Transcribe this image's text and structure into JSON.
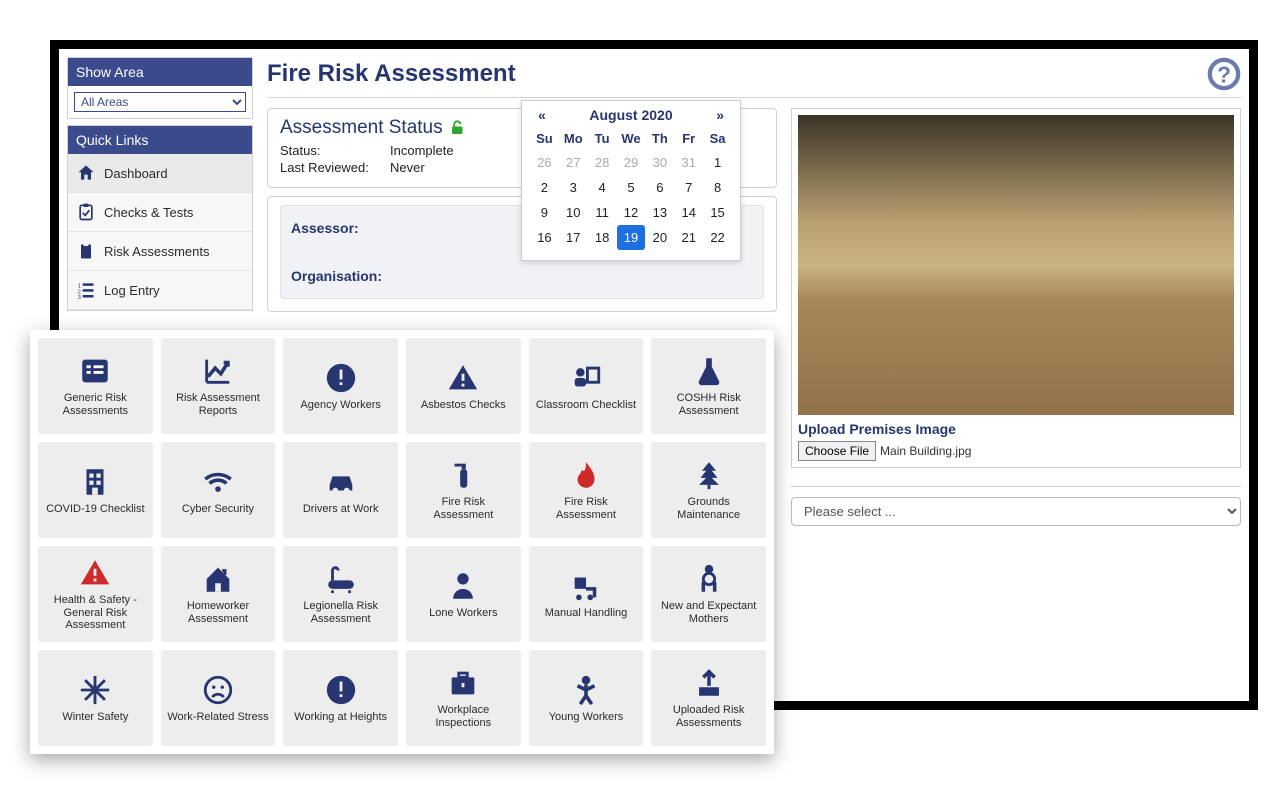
{
  "sidebar": {
    "show_area_title": "Show Area",
    "area_select_value": "All Areas",
    "quick_links_title": "Quick Links",
    "items": [
      {
        "icon": "home-icon",
        "label": "Dashboard"
      },
      {
        "icon": "clipboard-check-icon",
        "label": "Checks & Tests"
      },
      {
        "icon": "clipboard-icon",
        "label": "Risk Assessments"
      },
      {
        "icon": "list-number-icon",
        "label": "Log Entry"
      }
    ]
  },
  "page": {
    "title": "Fire Risk Assessment"
  },
  "status_panel": {
    "title": "Assessment Status",
    "lock_state": "unlocked",
    "rows": {
      "status_label": "Status:",
      "status_value": "Incomplete",
      "last_reviewed_label": "Last Reviewed:",
      "last_reviewed_value": "Never"
    }
  },
  "form": {
    "assessor_label": "Assessor:",
    "organisation_label": "Organisation:"
  },
  "calendar": {
    "prev": "«",
    "next": "»",
    "month_label": "August 2020",
    "dow": [
      "Su",
      "Mo",
      "Tu",
      "We",
      "Th",
      "Fr",
      "Sa"
    ],
    "rows": [
      {
        "days": [
          26,
          27,
          28,
          29,
          30,
          31,
          1
        ],
        "other": [
          0,
          1,
          2,
          3,
          4,
          5
        ]
      },
      {
        "days": [
          2,
          3,
          4,
          5,
          6,
          7,
          8
        ],
        "other": []
      },
      {
        "days": [
          9,
          10,
          11,
          12,
          13,
          14,
          15
        ],
        "other": []
      },
      {
        "days": [
          16,
          17,
          18,
          19,
          20,
          21,
          22
        ],
        "other": []
      }
    ],
    "selected": 19
  },
  "premises": {
    "upload_title": "Upload Premises Image",
    "choose_label": "Choose File",
    "file_name": "Main Building.jpg"
  },
  "lower_select_placeholder": "Please select ...",
  "tiles": [
    {
      "icon": "list-icon",
      "color": "navy",
      "label": "Generic Risk Assessments"
    },
    {
      "icon": "chart-line-icon",
      "color": "navy",
      "label": "Risk Assessment Reports"
    },
    {
      "icon": "exclaim-circle-icon",
      "color": "navy",
      "label": "Agency Workers"
    },
    {
      "icon": "warning-icon",
      "color": "navy",
      "label": "Asbestos Checks"
    },
    {
      "icon": "teacher-icon",
      "color": "navy",
      "label": "Classroom Checklist"
    },
    {
      "icon": "flask-icon",
      "color": "navy",
      "label": "COSHH Risk Assessment"
    },
    {
      "icon": "building-icon",
      "color": "navy",
      "label": "COVID-19 Checklist"
    },
    {
      "icon": "wifi-icon",
      "color": "navy",
      "label": "Cyber Security"
    },
    {
      "icon": "car-icon",
      "color": "navy",
      "label": "Drivers at Work"
    },
    {
      "icon": "extinguisher-icon",
      "color": "navy",
      "label": "Fire Risk Assessment"
    },
    {
      "icon": "flame-icon",
      "color": "red",
      "label": "Fire Risk Assessment"
    },
    {
      "icon": "tree-icon",
      "color": "navy",
      "label": "Grounds Maintenance"
    },
    {
      "icon": "warning-icon",
      "color": "red",
      "label": "Health & Safety - General Risk Assessment"
    },
    {
      "icon": "house-icon",
      "color": "navy",
      "label": "Homeworker Assessment"
    },
    {
      "icon": "bath-icon",
      "color": "navy",
      "label": "Legionella Risk Assessment"
    },
    {
      "icon": "person-icon",
      "color": "navy",
      "label": "Lone Workers"
    },
    {
      "icon": "trolley-icon",
      "color": "navy",
      "label": "Manual Handling"
    },
    {
      "icon": "mother-icon",
      "color": "navy",
      "label": "New and Expectant Mothers"
    },
    {
      "icon": "snowflake-icon",
      "color": "navy",
      "label": "Winter Safety"
    },
    {
      "icon": "sad-face-icon",
      "color": "navy",
      "label": "Work-Related Stress"
    },
    {
      "icon": "exclaim-circle-icon",
      "color": "navy",
      "label": "Working at Heights"
    },
    {
      "icon": "briefcase-icon",
      "color": "navy",
      "label": "Workplace Inspections"
    },
    {
      "icon": "child-icon",
      "color": "navy",
      "label": "Young Workers"
    },
    {
      "icon": "upload-icon",
      "color": "navy",
      "label": "Uploaded Risk Assessments"
    }
  ]
}
